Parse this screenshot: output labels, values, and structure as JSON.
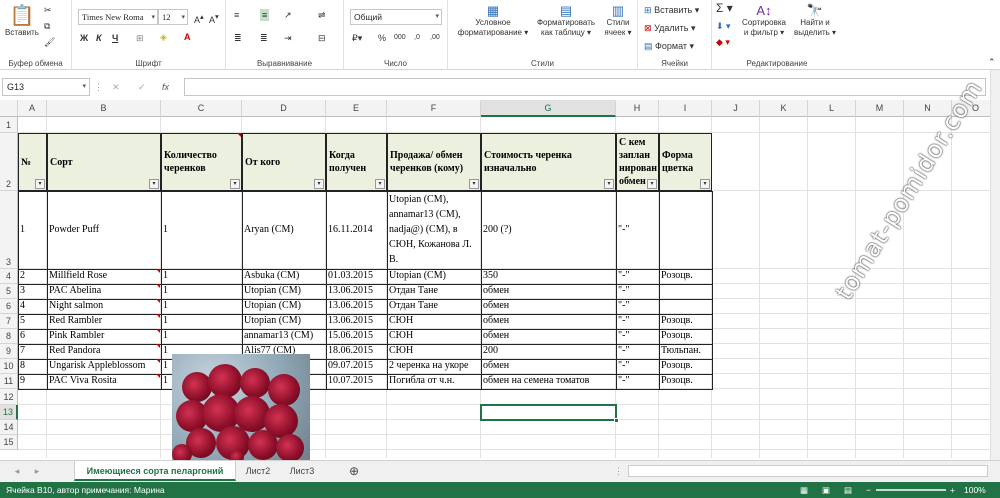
{
  "ribbon": {
    "paste": "Вставить",
    "clipboard": "Буфер обмена",
    "font_name": "Times New Roma",
    "font_size": "12",
    "bold": "Ж",
    "italic": "К",
    "underline": "Ч",
    "font_group": "Шрифт",
    "align_group": "Выравнивание",
    "number_format": "Общий",
    "number_group": "Число",
    "cond_fmt_1": "Условное",
    "cond_fmt_2": "форматирование",
    "fmt_table_1": "Форматировать",
    "fmt_table_2": "как таблицу",
    "cell_styles_1": "Стили",
    "cell_styles_2": "ячеек",
    "styles_group": "Стили",
    "insert": "Вставить",
    "delete": "Удалить",
    "format": "Формат",
    "cells_group": "Ячейки",
    "sort_1": "Сортировка",
    "sort_2": "и фильтр",
    "find_1": "Найти и",
    "find_2": "выделить",
    "edit_group": "Редактирование"
  },
  "formula_bar": {
    "name_box": "G13",
    "fx": "fx",
    "cancel": "✕",
    "enter": "✓",
    "formula": ""
  },
  "columns": [
    "A",
    "B",
    "C",
    "D",
    "E",
    "F",
    "G",
    "H",
    "I",
    "J",
    "K",
    "L",
    "M",
    "N",
    "O"
  ],
  "rows": [
    "1",
    "2",
    "3",
    "4",
    "5",
    "6",
    "7",
    "8",
    "9",
    "10",
    "11",
    "12",
    "13",
    "14",
    "15"
  ],
  "headers": {
    "a": "№",
    "b": "Сорт",
    "c": "Количество черенков",
    "d": "От кого",
    "e": "Когда получен",
    "f": "Продажа/ обмен черенков (кому)",
    "g": "Стоимость черенка изначально",
    "h": "С кем заплан нирован обмен",
    "i": "Форма цветка"
  },
  "row1": {
    "a": "1",
    "b": "Powder Puff",
    "c": "1",
    "d": "Aryan (CM)",
    "e": "16.11.2014",
    "f": "Utopian (CM), annamar13 (CM), nadja@) (CM), в СЮН, Кожанова Л. В.",
    "g": "200 (?)",
    "h": "\"-\""
  },
  "data": [
    {
      "a": "2",
      "b": "Millfield Rose",
      "c": "1",
      "d": "Asbuka (CM)",
      "e": "01.03.2015",
      "f": "Utopian (CM)",
      "g": "350",
      "h": "\"-\"",
      "i": "Розоцв."
    },
    {
      "a": "3",
      "b": "PAC Abelina",
      "c": "1",
      "d": "Utopian (CM)",
      "e": "13.06.2015",
      "f": "Отдан Тане",
      "g": "обмен",
      "h": "\"-\"",
      "i": ""
    },
    {
      "a": "4",
      "b": "Night salmon",
      "c": "1",
      "d": "Utopian (CM)",
      "e": "13.06.2015",
      "f": "Отдан Тане",
      "g": "обмен",
      "h": "\"-\"",
      "i": ""
    },
    {
      "a": "5",
      "b": "Red Rambler",
      "c": "1",
      "d": "Utopian (CM)",
      "e": "13.06.2015",
      "f": "СЮН",
      "g": "обмен",
      "h": "\"-\"",
      "i": "Розоцв."
    },
    {
      "a": "6",
      "b": "Pink Rambler",
      "c": "1",
      "d": "annamar13 (CM)",
      "e": "15.06.2015",
      "f": "СЮН",
      "g": "обмен",
      "h": "\"-\"",
      "i": "Розоцв."
    },
    {
      "a": "7",
      "b": "Red Pandora",
      "c": "1",
      "d": "Alis77 (CM)",
      "e": "18.06.2015",
      "f": "СЮН",
      "g": "200",
      "h": "\"-\"",
      "i": "Тюльпан."
    },
    {
      "a": "8",
      "b": "Ungarisk Appleblossom",
      "c": "1",
      "d": "",
      "e": "09.07.2015",
      "f": "2 черенка на укоре",
      "g": "обмен",
      "h": "\"-\"",
      "i": "Розоцв."
    },
    {
      "a": "9",
      "b": "PAC Viva Rosita",
      "c": "1",
      "d": "",
      "e": "10.07.2015",
      "f": "Погибла от ч.н.",
      "g": "обмен на семена томатов",
      "h": "\"-\"",
      "i": "Розоцв."
    }
  ],
  "sheets": [
    "Имеющиеся сорта пеларгоний",
    "Лист2",
    "Лист3"
  ],
  "status": {
    "left": "Ячейка B10, автор примечания: Марина",
    "zoom": "100%"
  },
  "watermark": "tomat-pomidor.com"
}
